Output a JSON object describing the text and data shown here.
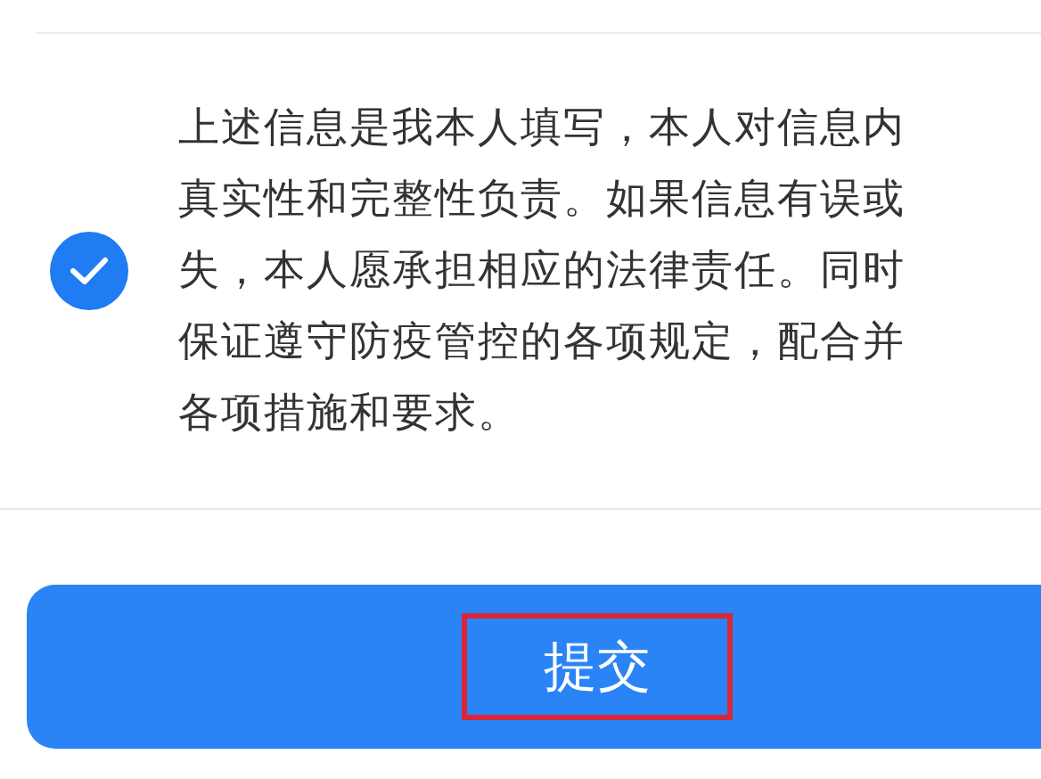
{
  "agreement": {
    "checked": true,
    "lines": [
      "上述信息是我本人填写，本人对信息内",
      "真实性和完整性负责。如果信息有误或",
      "失，本人愿承担相应的法律责任。同时",
      "保证遵守防疫管控的各项规定，配合并",
      "各项措施和要求。"
    ]
  },
  "submit_button": {
    "label": "提交",
    "highlighted": true
  }
}
